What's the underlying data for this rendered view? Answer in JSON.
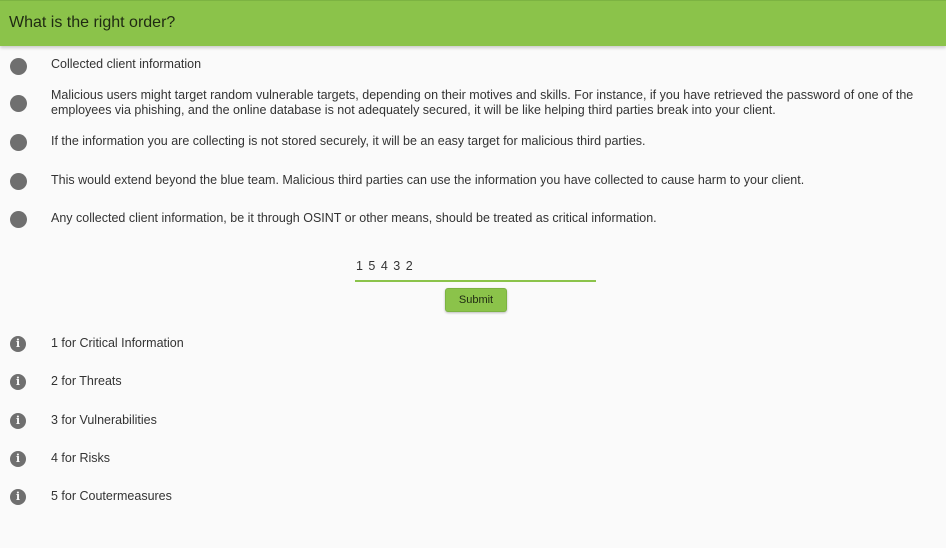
{
  "header": {
    "title": "What is the right order?"
  },
  "statements": [
    {
      "text": "Collected client information"
    },
    {
      "text": "Malicious users might target random vulnerable targets, depending on their motives and skills. For instance, if you have retrieved the password of one of the employees via phishing, and the online database is not adequately secured, it will be like helping third parties break into your client."
    },
    {
      "text": "If the information you are collecting is not stored securely, it will be an easy target for malicious third parties."
    },
    {
      "text": "This would extend beyond the blue team. Malicious third parties can use the information you have collected to cause harm to your client."
    },
    {
      "text": "Any collected client information, be it through OSINT or other means, should be treated as critical information."
    }
  ],
  "answer": {
    "value": "1 5 4 3 2"
  },
  "submit": {
    "label": "Submit"
  },
  "hints": [
    {
      "text": "1 for Critical Information",
      "icon": "info-icon"
    },
    {
      "text": "2 for Threats",
      "icon": "info-icon"
    },
    {
      "text": "3 for Vulnerabilities",
      "icon": "info-icon"
    },
    {
      "text": "4 for Risks",
      "icon": "info-icon"
    },
    {
      "text": "5 for Coutermeasures",
      "icon": "info-icon"
    }
  ],
  "colors": {
    "accent": "#8bc34a",
    "bullet": "#6f6f6f",
    "background": "#fafafa"
  }
}
